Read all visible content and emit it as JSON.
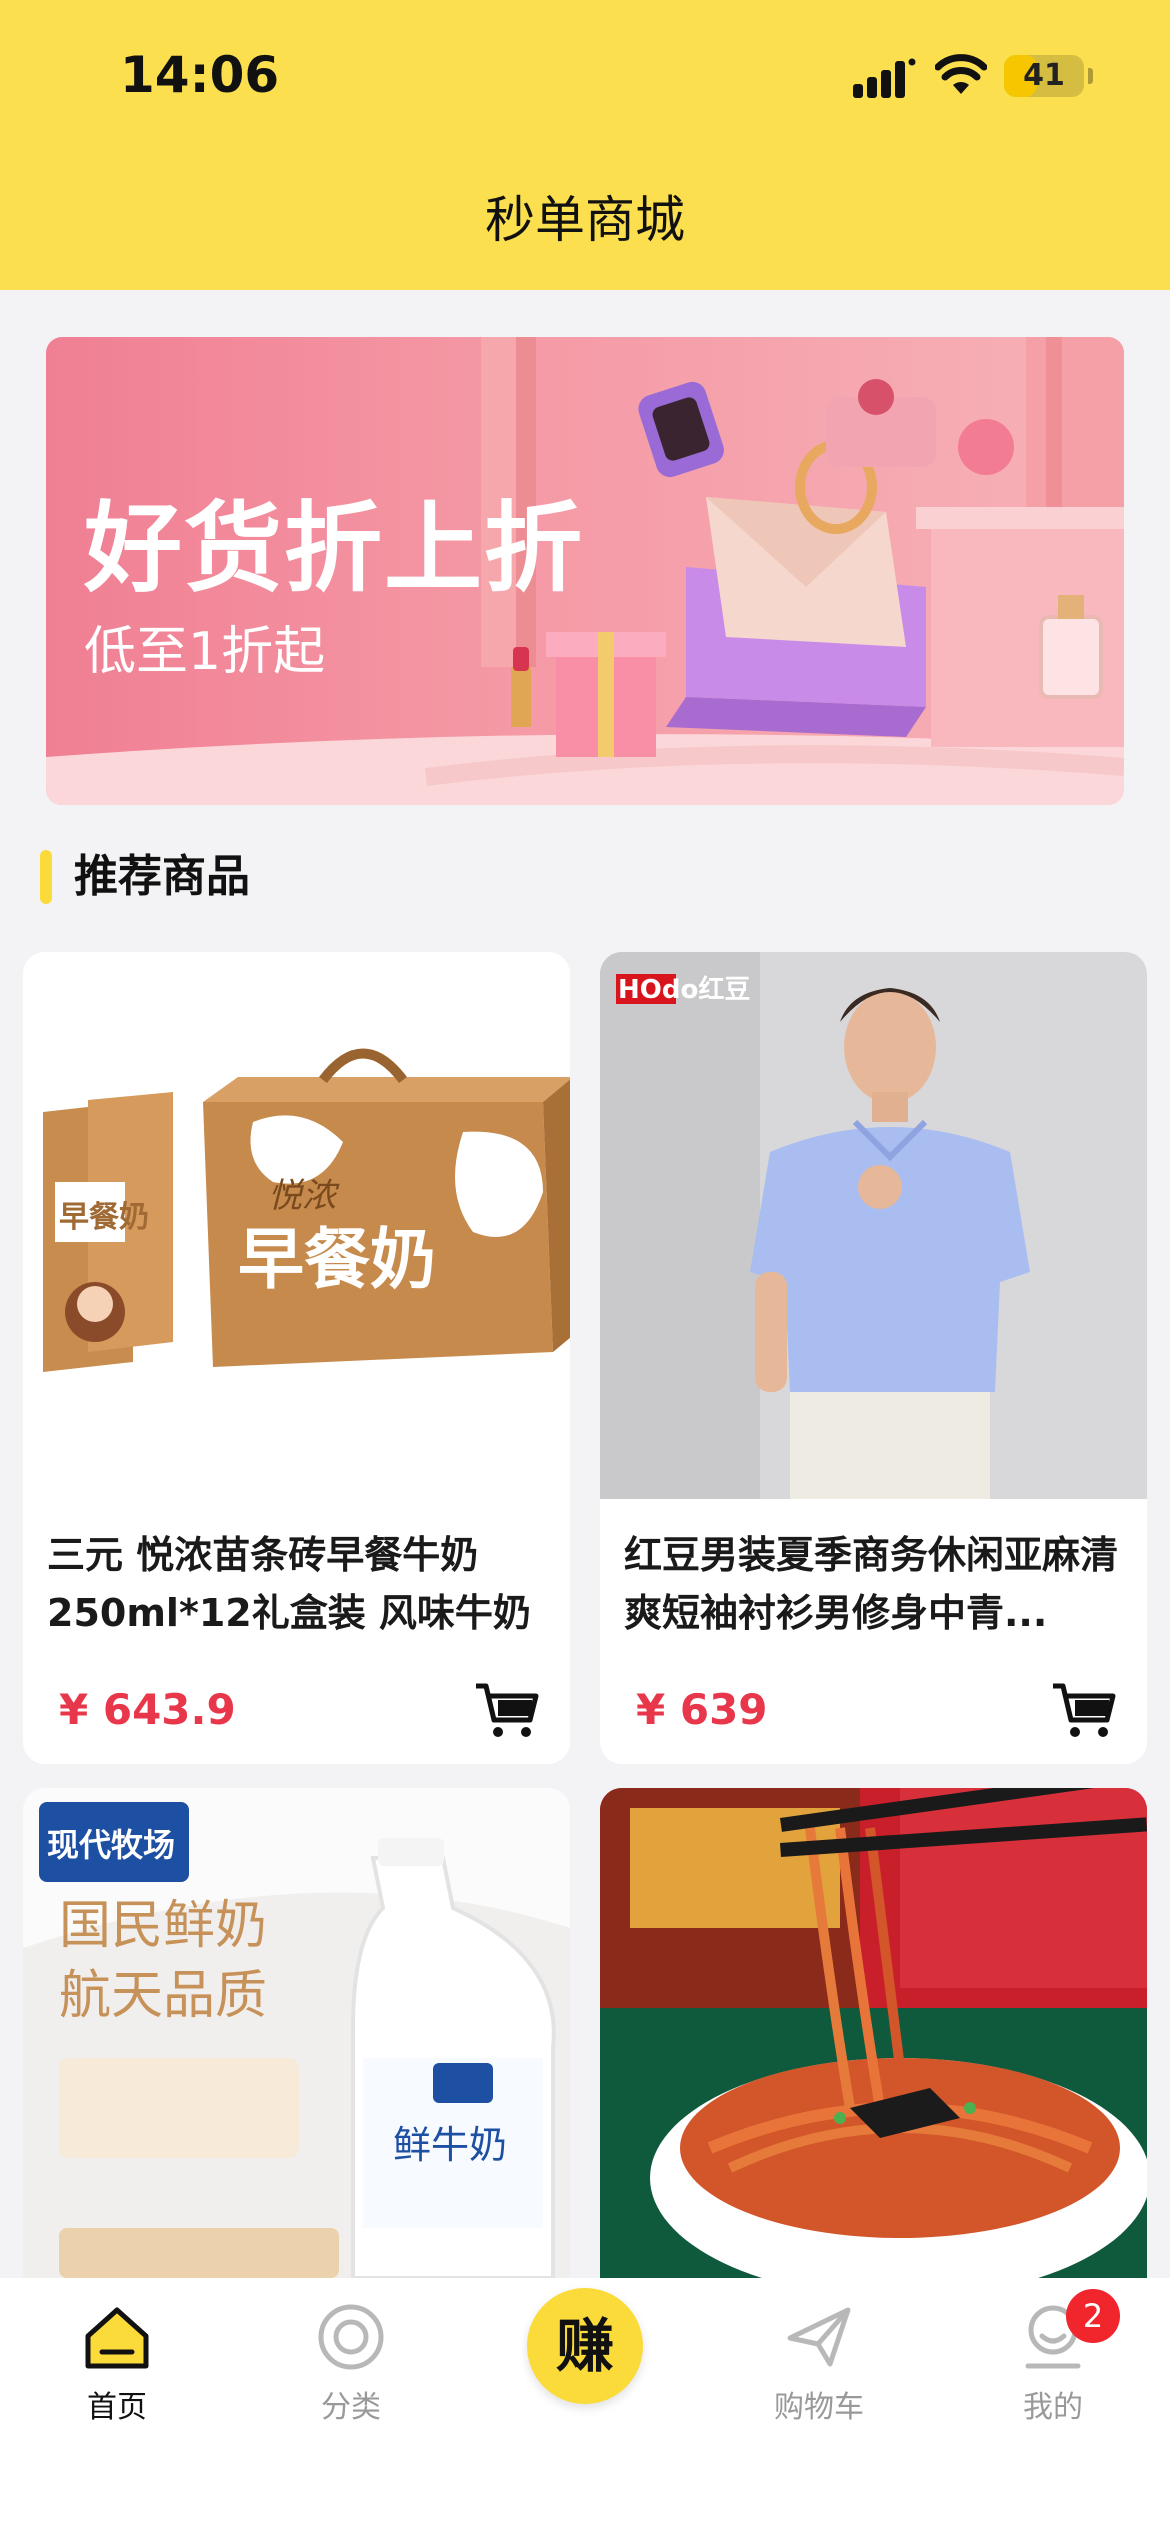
{
  "status_bar": {
    "time": "14:06",
    "battery_level": "41",
    "battery_fraction": 0.41
  },
  "nav": {
    "title": "秒单商城"
  },
  "banner": {
    "title": "好货折上折",
    "subtitle": "低至1折起"
  },
  "section": {
    "title": "推荐商品"
  },
  "products": [
    {
      "name": "三元 悦浓苗条砖早餐牛奶 250ml*12礼盒装 风味牛奶",
      "price": "¥ 643.9"
    },
    {
      "name": "红豆男装夏季商务休闲亚麻清爽短袖衬衫男修身中青...",
      "price": "¥ 639"
    },
    {
      "name": "",
      "price": ""
    },
    {
      "name": "",
      "price": ""
    }
  ],
  "product_images": {
    "milk_box": {
      "brand": "悦浓",
      "product": "早餐奶"
    },
    "shirt": {
      "brand_logo": "HOdo红豆"
    },
    "fresh_milk": {
      "brand": "现代牧场",
      "slogan1": "国民鲜奶",
      "slogan2": "航天品质",
      "bottle": "鲜牛奶"
    }
  },
  "tabbar": {
    "tabs": [
      {
        "label": "首页",
        "icon": "home-icon",
        "active": true
      },
      {
        "label": "分类",
        "icon": "category-icon",
        "active": false
      },
      {
        "label": "赚",
        "icon": "earn-button",
        "active": false
      },
      {
        "label": "购物车",
        "icon": "cart-icon",
        "active": false
      },
      {
        "label": "我的",
        "icon": "profile-icon",
        "active": false
      }
    ],
    "badge_count": "2"
  },
  "colors": {
    "header_bg": "#fbdf4e",
    "accent_yellow": "#fbdb3a",
    "price_red": "#e8374a",
    "badge_red": "#f0262c"
  }
}
